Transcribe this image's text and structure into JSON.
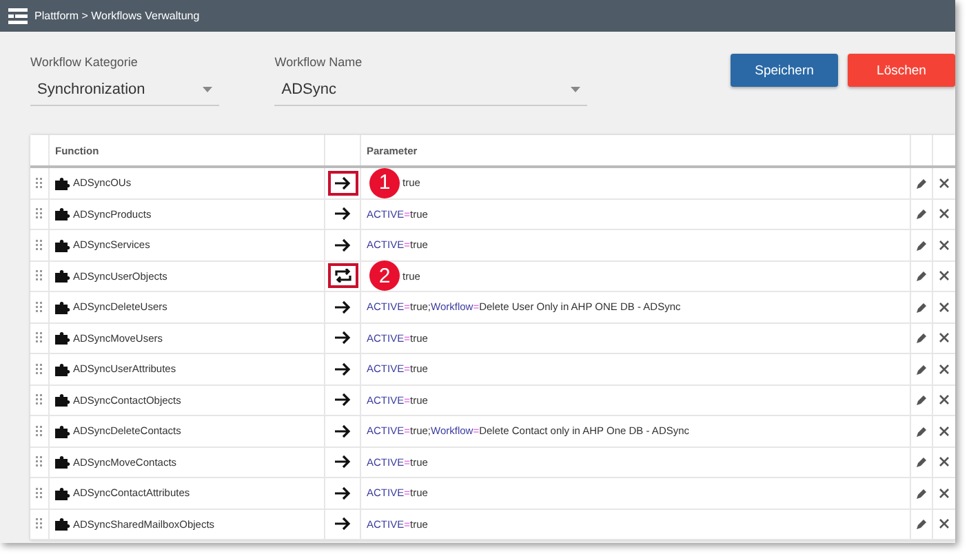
{
  "breadcrumb": "Plattform > Workflows Verwaltung",
  "category": {
    "label": "Workflow Kategorie",
    "value": "Synchronization"
  },
  "name": {
    "label": "Workflow Name",
    "value": "ADSync"
  },
  "buttons": [
    {
      "label": "Speichern",
      "kind": "primary"
    },
    {
      "label": "Löschen",
      "kind": "danger"
    }
  ],
  "table": {
    "columns": [
      "Function",
      "Parameter"
    ],
    "rows": [
      {
        "function": "ADSyncOUs",
        "kind": "arrow",
        "highlighted": true,
        "callout": "1",
        "parameter": [
          {
            "kind": "value",
            "text": "true"
          }
        ]
      },
      {
        "function": "ADSyncProducts",
        "kind": "arrow",
        "highlighted": false,
        "parameter": [
          {
            "kind": "key",
            "text": "ACTIVE"
          },
          {
            "kind": "sep",
            "text": "="
          },
          {
            "kind": "value",
            "text": "true"
          }
        ]
      },
      {
        "function": "ADSyncServices",
        "kind": "arrow",
        "highlighted": false,
        "parameter": [
          {
            "kind": "key",
            "text": "ACTIVE"
          },
          {
            "kind": "sep",
            "text": "="
          },
          {
            "kind": "value",
            "text": "true"
          }
        ]
      },
      {
        "function": "ADSyncUserObjects",
        "kind": "repeat",
        "highlighted": true,
        "callout": "2",
        "parameter": [
          {
            "kind": "value",
            "text": "true"
          }
        ]
      },
      {
        "function": "ADSyncDeleteUsers",
        "kind": "arrow",
        "highlighted": false,
        "parameter": [
          {
            "kind": "key",
            "text": "ACTIVE"
          },
          {
            "kind": "sep",
            "text": "="
          },
          {
            "kind": "value",
            "text": "true;"
          },
          {
            "kind": "key",
            "text": "Workflow"
          },
          {
            "kind": "sep",
            "text": "="
          },
          {
            "kind": "value",
            "text": "Delete User Only in AHP ONE DB - ADSync"
          }
        ]
      },
      {
        "function": "ADSyncMoveUsers",
        "kind": "arrow",
        "highlighted": false,
        "parameter": [
          {
            "kind": "key",
            "text": "ACTIVE"
          },
          {
            "kind": "sep",
            "text": "="
          },
          {
            "kind": "value",
            "text": "true"
          }
        ]
      },
      {
        "function": "ADSyncUserAttributes",
        "kind": "arrow",
        "highlighted": false,
        "parameter": [
          {
            "kind": "key",
            "text": "ACTIVE"
          },
          {
            "kind": "sep",
            "text": "="
          },
          {
            "kind": "value",
            "text": "true"
          }
        ]
      },
      {
        "function": "ADSyncContactObjects",
        "kind": "arrow",
        "highlighted": false,
        "parameter": [
          {
            "kind": "key",
            "text": "ACTIVE"
          },
          {
            "kind": "sep",
            "text": "="
          },
          {
            "kind": "value",
            "text": "true"
          }
        ]
      },
      {
        "function": "ADSyncDeleteContacts",
        "kind": "arrow",
        "highlighted": false,
        "parameter": [
          {
            "kind": "key",
            "text": "ACTIVE"
          },
          {
            "kind": "sep",
            "text": "="
          },
          {
            "kind": "value",
            "text": "true;"
          },
          {
            "kind": "key",
            "text": "Workflow"
          },
          {
            "kind": "sep",
            "text": "="
          },
          {
            "kind": "value",
            "text": "Delete Contact only in AHP One DB - ADSync"
          }
        ]
      },
      {
        "function": "ADSyncMoveContacts",
        "kind": "arrow",
        "highlighted": false,
        "parameter": [
          {
            "kind": "key",
            "text": "ACTIVE"
          },
          {
            "kind": "sep",
            "text": "="
          },
          {
            "kind": "value",
            "text": "true"
          }
        ]
      },
      {
        "function": "ADSyncContactAttributes",
        "kind": "arrow",
        "highlighted": false,
        "parameter": [
          {
            "kind": "key",
            "text": "ACTIVE"
          },
          {
            "kind": "sep",
            "text": "="
          },
          {
            "kind": "value",
            "text": "true"
          }
        ]
      },
      {
        "function": "ADSyncSharedMailboxObjects",
        "kind": "arrow",
        "highlighted": false,
        "parameter": [
          {
            "kind": "key",
            "text": "ACTIVE"
          },
          {
            "kind": "sep",
            "text": "="
          },
          {
            "kind": "value",
            "text": "true"
          }
        ]
      }
    ]
  }
}
